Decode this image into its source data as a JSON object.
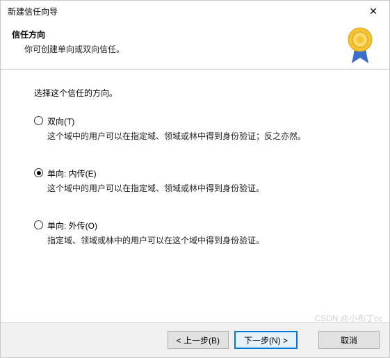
{
  "titlebar": {
    "title": "新建信任向导",
    "close_icon": "✕"
  },
  "header": {
    "title": "信任方向",
    "subtitle": "你可创建单向或双向信任。"
  },
  "content": {
    "prompt": "选择这个信任的方向。",
    "options": [
      {
        "label": "双向(T)",
        "desc": "这个域中的用户可以在指定域、领域或林中得到身份验证；反之亦然。",
        "selected": false
      },
      {
        "label": "单向: 内传(E)",
        "desc": "这个域中的用户可以在指定域、领域或林中得到身份验证。",
        "selected": true
      },
      {
        "label": "单向: 外传(O)",
        "desc": "指定域、领域或林中的用户可以在这个域中得到身份验证。",
        "selected": false
      }
    ]
  },
  "footer": {
    "back": "< 上一步(B)",
    "next": "下一步(N) >",
    "cancel": "取消"
  },
  "watermark": "CSDN @小布丁cc"
}
